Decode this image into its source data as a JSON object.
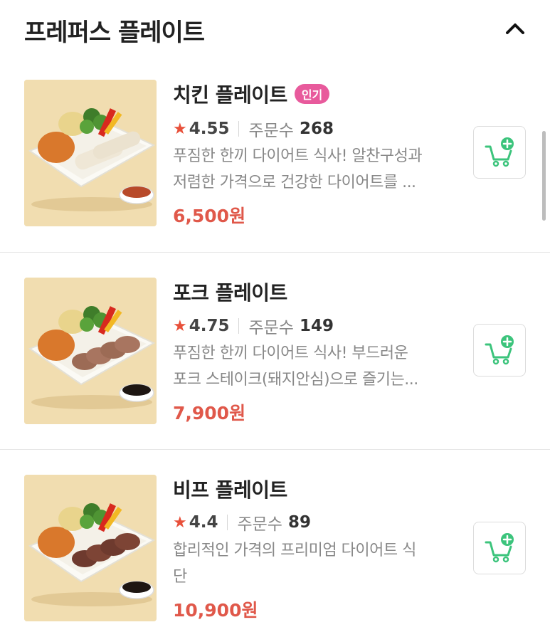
{
  "section": {
    "title": "프레퍼스 플레이트",
    "collapse_icon": "chevron-up-icon"
  },
  "products": [
    {
      "name": "치킨 플레이트",
      "badge": "인기",
      "rating": "4.55",
      "orders_label": "주문수",
      "orders": "268",
      "desc_line1": "푸짐한 한끼 다이어트 식사! 알찬구성과",
      "desc_line2": "저렴한 가격으로 건강한 다이어트를 ...",
      "price": "6,500원",
      "image_icon": "chicken-plate-photo",
      "cart_icon": "cart-add-icon"
    },
    {
      "name": "포크 플레이트",
      "rating": "4.75",
      "orders_label": "주문수",
      "orders": "149",
      "desc_line1": "푸짐한 한끼 다이어트 식사! 부드러운",
      "desc_line2": "포크 스테이크(돼지안심)으로 즐기는...",
      "price": "7,900원",
      "image_icon": "pork-plate-photo",
      "cart_icon": "cart-add-icon"
    },
    {
      "name": "비프 플레이트",
      "rating": "4.4",
      "orders_label": "주문수",
      "orders": "89",
      "desc_line1": "합리적인 가격의 프리미엄 다이어트 식",
      "desc_line2": "단",
      "price": "10,900원",
      "image_icon": "beef-plate-photo",
      "cart_icon": "cart-add-icon"
    }
  ],
  "colors": {
    "accent_red": "#e0584a",
    "star": "#e8503a",
    "badge": "#e85a9c",
    "cart_green": "#3cc47c",
    "image_bg": "#f1ddb0"
  }
}
